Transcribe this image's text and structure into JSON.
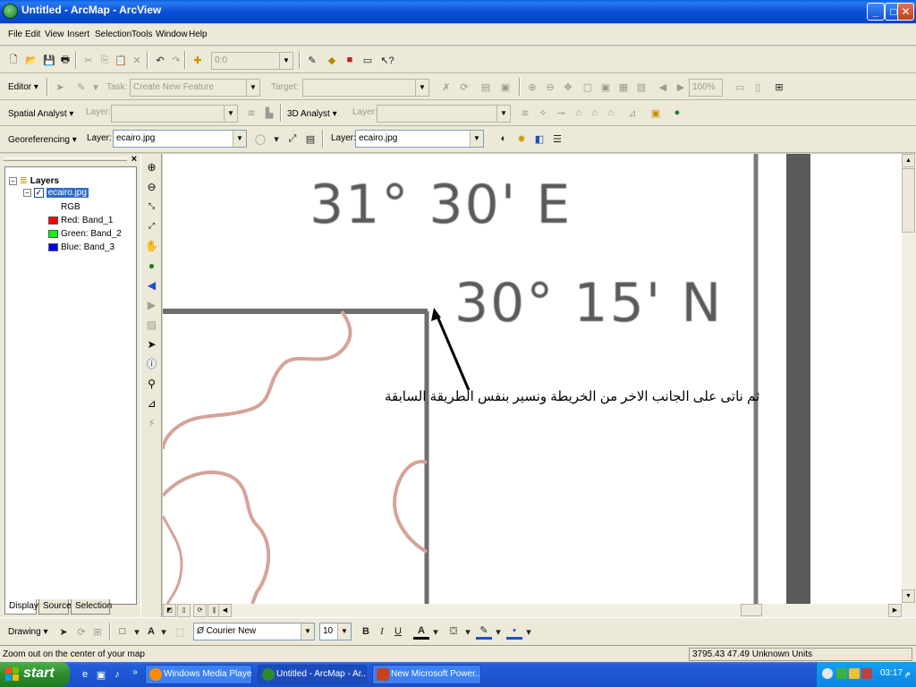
{
  "window": {
    "title": "Untitled - ArcMap - ArcView",
    "minimize": "_",
    "maximize": "□",
    "close": "✕"
  },
  "menu": [
    "File",
    "Edit",
    "View",
    "Insert",
    "Selection",
    "Tools",
    "Window",
    "Help"
  ],
  "standard_toolbar": {
    "scale_value": "0:0",
    "icons": [
      "new-icon",
      "open-icon",
      "save-icon",
      "print-icon",
      "cut-icon",
      "copy-icon",
      "paste-icon",
      "delete-icon",
      "undo-icon",
      "redo-icon",
      "add-data-icon",
      "editor-toolbar-icon",
      "arccatalog-icon",
      "arctoolbox-icon",
      "command-line-icon",
      "whats-this-icon"
    ]
  },
  "editor_toolbar": {
    "editor_label": "Editor",
    "task_label": "Task:",
    "task_value": "Create New Feature",
    "target_label": "Target:",
    "target_value": "",
    "zoom_value": "100%"
  },
  "spatial_toolbar": {
    "spatial_label": "Spatial Analyst",
    "layer_label_1": "Layer:",
    "analyst3d_label": "3D Analyst",
    "layer_label_2": "Layer:"
  },
  "georef_toolbar": {
    "georef_label": "Georeferencing",
    "layer_label_1": "Layer:",
    "layer_value_1": "ecairo.jpg",
    "layer_label_2": "Layer:",
    "layer_value_2": "ecairo.jpg"
  },
  "toc": {
    "root": "Layers",
    "layer_name": "ecairo.jpg",
    "rgb_label": "RGB",
    "bands": [
      {
        "label": "Red:   Band_1",
        "color": "#ff0000"
      },
      {
        "label": "Green: Band_2",
        "color": "#00ff00"
      },
      {
        "label": "Blue:   Band_3",
        "color": "#0000ff"
      }
    ],
    "tabs": [
      "Display",
      "Source",
      "Selection"
    ]
  },
  "map": {
    "longitude_label": "31° 30' E",
    "latitude_label": "30° 15' N",
    "annotation": "ثم ناتى على الجانب الاخر من الخريطة ونسير بنفس الطريقة السابقة"
  },
  "drawing_toolbar": {
    "drawing_label": "Drawing",
    "font_name": "Courier New",
    "font_size": "10",
    "bold": "B",
    "italic": "I",
    "underline": "U",
    "font_color_label": "A"
  },
  "status": {
    "message": "Zoom out on the center of your map",
    "coordinates": "3795.43  47.49 Unknown Units"
  },
  "taskbar": {
    "start_label": "start",
    "tasks": [
      "Windows Media Player",
      "Untitled - ArcMap - Ar...",
      "New Microsoft Power..."
    ],
    "time": "03:17 م"
  }
}
